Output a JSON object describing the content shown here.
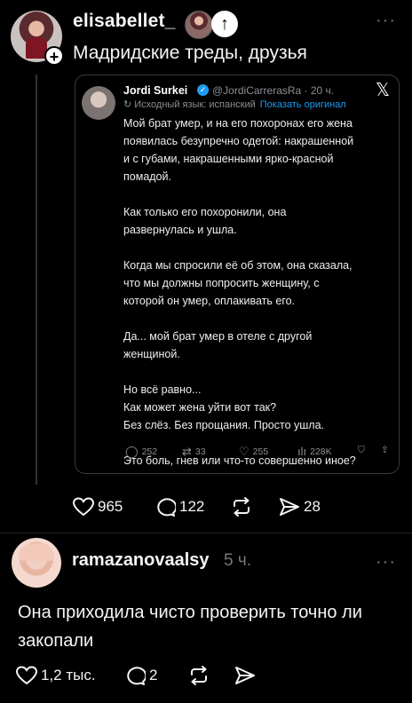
{
  "post": {
    "username": "elisabellet_",
    "caption": "Мадридские треды, друзья",
    "more": "···",
    "plus": "+",
    "tag_arrow": "↑",
    "stats": {
      "likes": "965",
      "comments": "122",
      "shares": "28"
    }
  },
  "tweet": {
    "name": "Jordi Surkei",
    "verified": "✓",
    "handle": "@JordiCarrerasRa · 20 ч.",
    "x_logo": "𝕏",
    "lang_note": "↻ Исходный язык: испанский",
    "show_original": "Показать оригинал",
    "body": "Мой брат умер, и на его похоронах его жена\nпоявилась безупречно одетой: накрашенной\nи с губами, накрашенными ярко-красной\nпомадой.\n\nКак только его похоронили, она\nразвернулась и ушла.\n\nКогда мы спросили её об этом, она сказала,\nчто мы должны попросить женщину, с\nкоторой он умер, оплакивать его.\n\nДа... мой брат умер в отеле с другой\nженщиной.\n\nНо всё равно...\nКак может жена уйти вот так?\nБез слёз. Без прощания. Просто ушла.\n\nЭто боль, гнев или что-то совершенно иное?",
    "stats": {
      "replies": "252",
      "retweets": "33",
      "likes": "255",
      "views": "228K"
    }
  },
  "reply": {
    "username": "ramazanovaalsy",
    "time": "5 ч.",
    "more": "···",
    "text": "Она приходила чисто проверить точно ли закопали",
    "stats": {
      "likes": "1,2 тыс.",
      "comments": "2"
    }
  }
}
